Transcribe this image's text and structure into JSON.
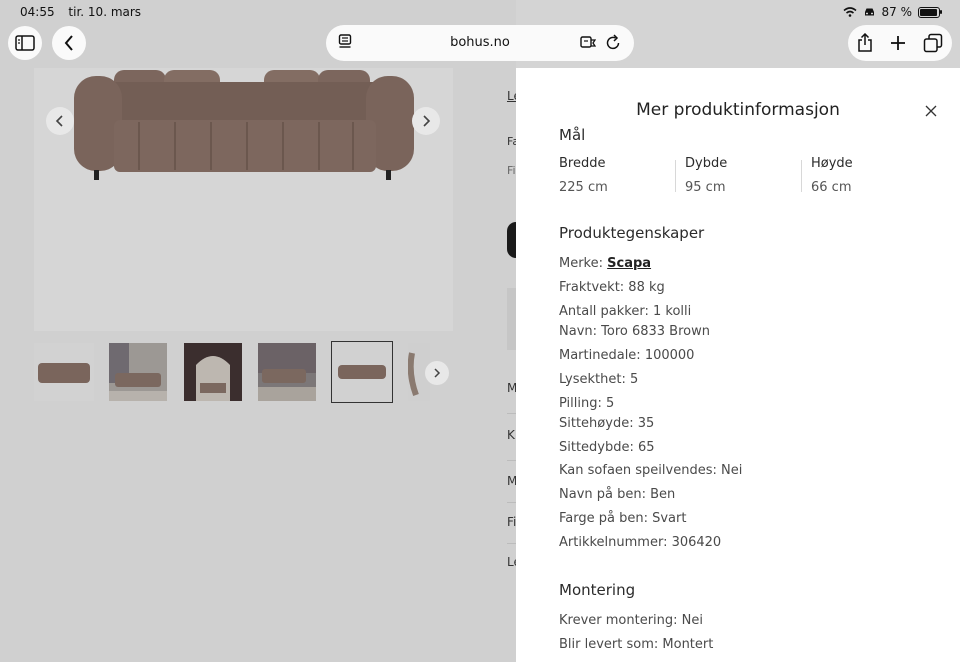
{
  "status_bar": {
    "time": "04:55",
    "date": "tir. 10. mars",
    "battery_text": "87 %",
    "battery_level": 0.87
  },
  "browser": {
    "url": "bohus.no"
  },
  "page_strip": {
    "items": [
      "Le",
      "Fa",
      "Fi",
      "M",
      "K",
      "M",
      "Fi",
      "Le"
    ]
  },
  "drawer": {
    "title": "Mer produktinformasjon",
    "dimensions": {
      "heading": "Mål",
      "items": [
        {
          "label": "Bredde",
          "value": "225 cm"
        },
        {
          "label": "Dybde",
          "value": "95 cm"
        },
        {
          "label": "Høyde",
          "value": "66 cm"
        }
      ]
    },
    "properties": {
      "heading": "Produktegenskaper",
      "brand_label": "Merke: ",
      "brand_link": "Scapa",
      "items": [
        "Fraktvekt: 88 kg",
        "Antall pakker: 1 kolli",
        "Navn: Toro 6833 Brown",
        "Martinedale: 100000",
        "Lysekthet: 5",
        "Pilling: 5",
        "Sittehøyde: 35",
        "Sittedybde: 65",
        "Kan sofaen speilvendes: Nei",
        "Navn på ben: Ben",
        "Farge på ben: Svart",
        "Artikkelnummer: 306420"
      ]
    },
    "assembly": {
      "heading": "Montering",
      "items": [
        "Krever montering: Nei",
        "Blir levert som: Montert"
      ]
    }
  }
}
